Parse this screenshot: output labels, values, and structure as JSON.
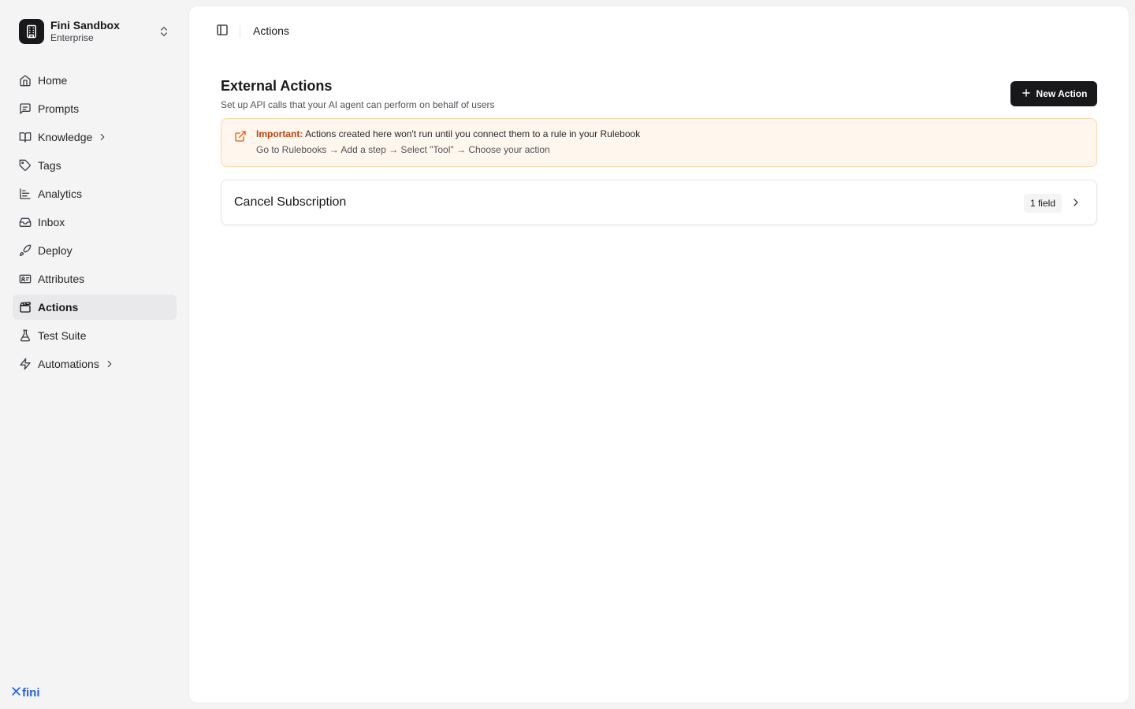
{
  "workspace": {
    "name": "Fini Sandbox",
    "plan": "Enterprise"
  },
  "sidebar": {
    "items": [
      {
        "label": "Home",
        "icon": "home-icon",
        "active": false,
        "has_submenu": false
      },
      {
        "label": "Prompts",
        "icon": "message-square-icon",
        "active": false,
        "has_submenu": false
      },
      {
        "label": "Knowledge",
        "icon": "book-open-icon",
        "active": false,
        "has_submenu": true
      },
      {
        "label": "Tags",
        "icon": "tag-icon",
        "active": false,
        "has_submenu": false
      },
      {
        "label": "Analytics",
        "icon": "bar-chart-icon",
        "active": false,
        "has_submenu": false
      },
      {
        "label": "Inbox",
        "icon": "inbox-icon",
        "active": false,
        "has_submenu": false
      },
      {
        "label": "Deploy",
        "icon": "rocket-icon",
        "active": false,
        "has_submenu": false
      },
      {
        "label": "Attributes",
        "icon": "id-card-icon",
        "active": false,
        "has_submenu": false
      },
      {
        "label": "Actions",
        "icon": "clapperboard-icon",
        "active": true,
        "has_submenu": false
      },
      {
        "label": "Test Suite",
        "icon": "flask-icon",
        "active": false,
        "has_submenu": false
      },
      {
        "label": "Automations",
        "icon": "zap-icon",
        "active": false,
        "has_submenu": true
      }
    ],
    "brand": "fini"
  },
  "topbar": {
    "breadcrumb": "Actions"
  },
  "main": {
    "title": "External Actions",
    "subtitle": "Set up API calls that your AI agent can perform on behalf of users",
    "new_button_label": "New Action",
    "notice": {
      "strong": "Important:",
      "message": "Actions created here won't run until you connect them to a rule in your Rulebook",
      "steps": "Go to Rulebooks → Add a step → Select \"Tool\" → Choose your action"
    },
    "actions": [
      {
        "name": "Cancel Subscription",
        "badge": "1 field"
      }
    ]
  },
  "colors": {
    "accent": "#18181b",
    "notice_bg": "#fff7ed",
    "notice_border": "#fed7aa",
    "notice_strong": "#c2410c",
    "brand": "#2563eb",
    "active_nav": "#e9e9eb"
  }
}
